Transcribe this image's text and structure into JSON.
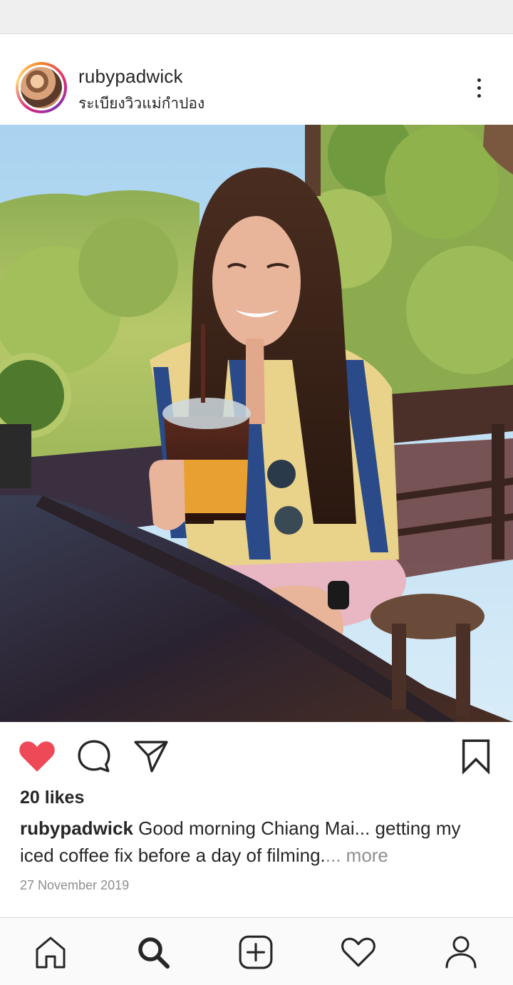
{
  "post": {
    "username": "rubypadwick",
    "location": "ระเบียงวิวแม่กำปอง",
    "likes": "20 likes",
    "caption_user": "rubypadwick",
    "caption_text": " Good morning Chiang Mai... getting my iced coffee fix before a day of filming.",
    "caption_more": "... more",
    "date": "27 November 2019",
    "liked": true
  },
  "icons": {
    "like": "heart-filled-icon",
    "comment": "comment-bubble-icon",
    "share": "paper-plane-icon",
    "save": "bookmark-icon",
    "options": "more-options-icon"
  },
  "nav": [
    {
      "icon": "home-icon"
    },
    {
      "icon": "search-icon",
      "active": true
    },
    {
      "icon": "new-post-icon"
    },
    {
      "icon": "activity-heart-icon"
    },
    {
      "icon": "profile-icon"
    }
  ],
  "colors": {
    "like_red": "#ed4956",
    "text": "#262626",
    "muted": "#8e8e8e"
  }
}
